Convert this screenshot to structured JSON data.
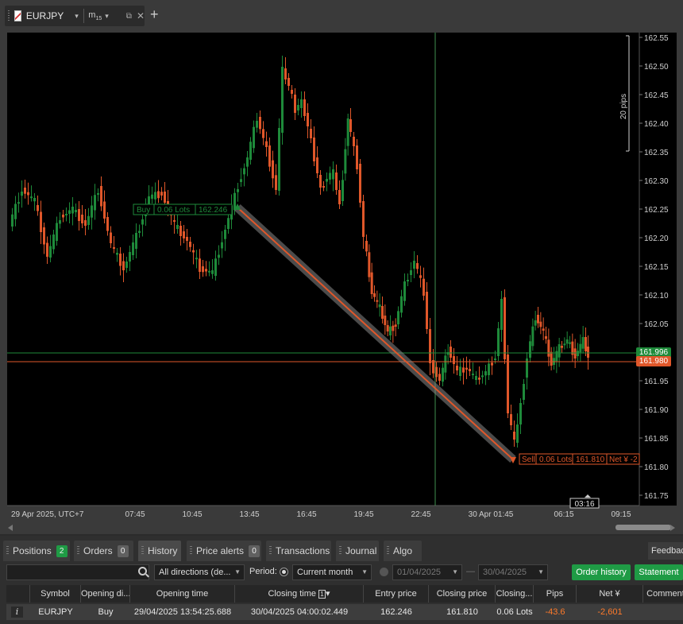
{
  "tab": {
    "symbol": "EURJPY",
    "timeframe": "m",
    "timeframe_sub": "15",
    "caret": "▾",
    "popout_icon": "popout-icon",
    "close_glyph": "✕",
    "add_glyph": "+"
  },
  "chart": {
    "price_labels": [
      "162.55",
      "162.50",
      "162.45",
      "162.40",
      "162.35",
      "162.30",
      "162.25",
      "162.20",
      "162.15",
      "162.10",
      "162.05",
      "162.00",
      "161.95",
      "161.90",
      "161.85",
      "161.80",
      "161.75"
    ],
    "time_labels": [
      "29 Apr 2025, UTC+7",
      "07:45",
      "10:45",
      "13:45",
      "16:45",
      "19:45",
      "22:45",
      "30 Apr 01:45",
      "06:15",
      "09:15"
    ],
    "countdown": "03:16",
    "pips_label": "20 pips",
    "bid_tag": "161.996",
    "ask_tag": "161.980",
    "buy_marker": {
      "side": "Buy",
      "lots": "0.06 Lots",
      "price": "162.246"
    },
    "sell_marker": {
      "side": "Sell",
      "lots": "0.06 Lots",
      "price": "161.810",
      "net": "Net ¥ -2"
    },
    "colors": {
      "up": "#1e8a3a",
      "down": "#e0572a",
      "background": "#000000"
    }
  },
  "panel": {
    "tabs": [
      {
        "label": "Positions",
        "badge": "2"
      },
      {
        "label": "Orders",
        "badge": "0"
      },
      {
        "label": "History"
      },
      {
        "label": "Price alerts",
        "badge": "0"
      },
      {
        "label": "Transactions"
      },
      {
        "label": "Journal"
      },
      {
        "label": "Algo"
      }
    ],
    "feedback": "Feedback",
    "filters": {
      "search_placeholder": "",
      "direction": "All directions (de...",
      "period_label": "Period:",
      "period_value": "Current month",
      "from_date": "01/04/2025",
      "to_date": "30/04/2025",
      "date_sep": "—",
      "order_history": "Order history",
      "statement": "Statement"
    },
    "columns": [
      "Symbol",
      "Opening di...",
      "Opening time",
      "Closing time",
      "Entry price",
      "Closing price",
      "Closing...",
      "Pips",
      "Net ¥",
      "Comment"
    ],
    "sort_badge": "1",
    "sort_arrow": "▾",
    "rows": [
      {
        "info": "i",
        "symbol": "EURJPY",
        "direction": "Buy",
        "opening_time": "29/04/2025 13:54:25.688",
        "closing_time": "30/04/2025 04:00:02.449",
        "entry_price": "162.246",
        "closing_price": "161.810",
        "closing_qty": "0.06 Lots",
        "pips": "-43.6",
        "net": "-2,601"
      }
    ]
  }
}
